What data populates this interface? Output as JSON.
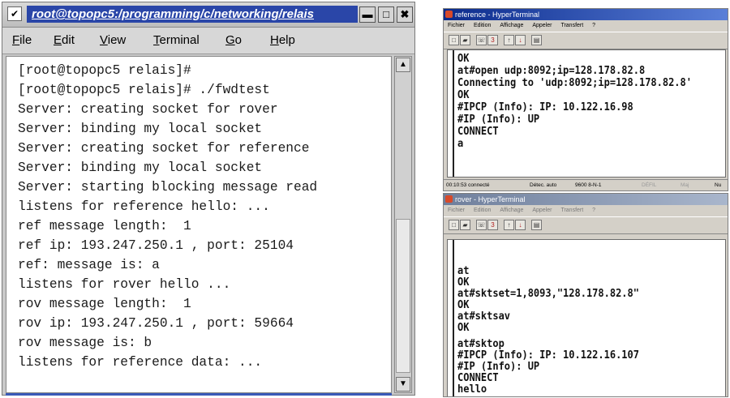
{
  "terminal": {
    "title": "root@topopc5:/programming/c/networking/relais",
    "menu": [
      "File",
      "Edit",
      "View",
      "Terminal",
      "Go",
      "Help"
    ],
    "menu_underline": [
      "F",
      "E",
      "V",
      "T",
      "G",
      "H"
    ],
    "menu_rest": [
      "ile",
      "dit",
      "iew",
      "erminal",
      "o",
      "elp"
    ],
    "lines": [
      "[root@topopc5 relais]#",
      "[root@topopc5 relais]# ./fwdtest",
      "Server: creating socket for rover",
      "Server: binding my local socket",
      "Server: creating socket for reference",
      "Server: binding my local socket",
      "Server: starting blocking message read",
      "listens for reference hello: ...",
      "ref message length:  1",
      "ref ip: 193.247.250.1 , port: 25104",
      "ref: message is: a",
      "listens for rover hello ...",
      "rov message length:  1",
      "rov ip: 193.247.250.1 , port: 59664",
      "rov message is: b",
      "listens for reference data: ..."
    ],
    "buttons": {
      "menu": "✔",
      "minimize": "▬",
      "maximize": "□",
      "close": "✖"
    }
  },
  "reference_window": {
    "title": "reference - HyperTerminal",
    "menu": [
      "Fichier",
      "Edition",
      "Affichage",
      "Appeler",
      "Transfert",
      "?"
    ],
    "lines": [
      "OK",
      "at#open udp:8092;ip=128.178.82.8",
      "Connecting to 'udp:8092;ip=128.178.82.8'",
      "OK",
      "#IPCP (Info): IP: 10.122.16.98",
      "#IP (Info): UP",
      "CONNECT",
      "a"
    ],
    "status": [
      "00:10:53 connecté",
      "Détec. auto",
      "9600 8-N-1",
      "DÉFIL",
      "Maj",
      "Nu"
    ]
  },
  "rover_window": {
    "title": "rover - HyperTerminal",
    "menu": [
      "Fichier",
      "Edition",
      "Affichage",
      "Appeler",
      "Transfert",
      "?"
    ],
    "lines": [
      "at",
      "OK",
      "at#sktset=1,8093,\"128.178.82.8\"",
      "OK",
      "at#sktsav",
      "OK",
      "at#sktop",
      "#IPCP (Info): IP: 10.122.16.107",
      "#IP (Info): UP",
      "CONNECT",
      "hello"
    ]
  },
  "icons": {
    "toolbar": [
      "new-icon",
      "open-icon",
      "call-icon",
      "disconnect-icon",
      "send-icon",
      "receive-icon",
      "properties-icon"
    ]
  }
}
